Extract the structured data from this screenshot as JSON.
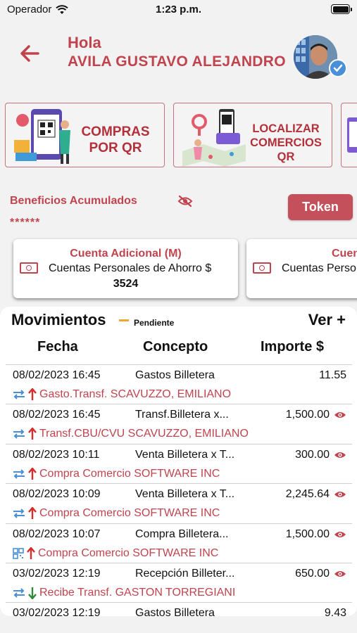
{
  "status": {
    "carrier": "Operador",
    "time": "1:23 p.m."
  },
  "header": {
    "greeting": "Hola",
    "user_name": "AVILA GUSTAVO ALEJANDRO"
  },
  "promos": [
    {
      "line1": "COMPRAS",
      "line2": "POR QR"
    },
    {
      "line1": "LOCALIZAR",
      "line2": "COMERCIOS QR"
    }
  ],
  "benefits": {
    "label": "Beneficios Acumulados",
    "masked_value": "******",
    "token_label": "Token"
  },
  "accounts": [
    {
      "title": "Cuenta Adicional (M)",
      "subtitle": "Cuentas Personales de Ahorro $",
      "number": "3524"
    },
    {
      "title": "Cuen",
      "subtitle": "Cuentas Perso"
    }
  ],
  "movements": {
    "title": "Movimientos",
    "pending_label": "Pendiente",
    "see_more": "Ver +",
    "columns": {
      "date": "Fecha",
      "concept": "Concepto",
      "amount": "Importe $"
    },
    "rows": [
      {
        "date": "08/02/2023 16:45",
        "concept": "Gastos Billetera",
        "amount": "11.55",
        "description": "Gasto.Transf. SCAVUZZO, EMILIANO",
        "channel_icon": "transfer-icon",
        "direction": "up"
      },
      {
        "date": "08/02/2023 16:45",
        "concept": "Transf.Billetera x...",
        "amount": "1,500.00",
        "description": "Transf.CBU/CVU SCAVUZZO, EMILIANO",
        "channel_icon": "transfer-icon",
        "direction": "up"
      },
      {
        "date": "08/02/2023 10:11",
        "concept": "Venta Billetera x T...",
        "amount": "300.00",
        "description": "Compra Comercio SOFTWARE INC",
        "channel_icon": "transfer-icon",
        "direction": "up"
      },
      {
        "date": "08/02/2023 10:09",
        "concept": "Venta Billetera x T...",
        "amount": "2,245.64",
        "description": "Compra Comercio SOFTWARE INC",
        "channel_icon": "transfer-icon",
        "direction": "up"
      },
      {
        "date": "08/02/2023 10:07",
        "concept": "Compra Billetera...",
        "amount": "1,500.00",
        "description": "Compra Comercio SOFTWARE INC",
        "channel_icon": "qr-icon",
        "direction": "up"
      },
      {
        "date": "03/02/2023 12:19",
        "concept": "Recepción Billeter...",
        "amount": "650.00",
        "description": "Recibe Transf. GASTON TORREGIANI",
        "channel_icon": "transfer-icon",
        "direction": "down"
      },
      {
        "date": "03/02/2023 12:19",
        "concept": "Gastos Billetera",
        "amount": "9.43"
      }
    ]
  },
  "colors": {
    "brand_red": "#c0444e",
    "pending": "#f0a830",
    "link_blue": "#4a8fd6",
    "incoming_green": "#2e8b3a"
  }
}
